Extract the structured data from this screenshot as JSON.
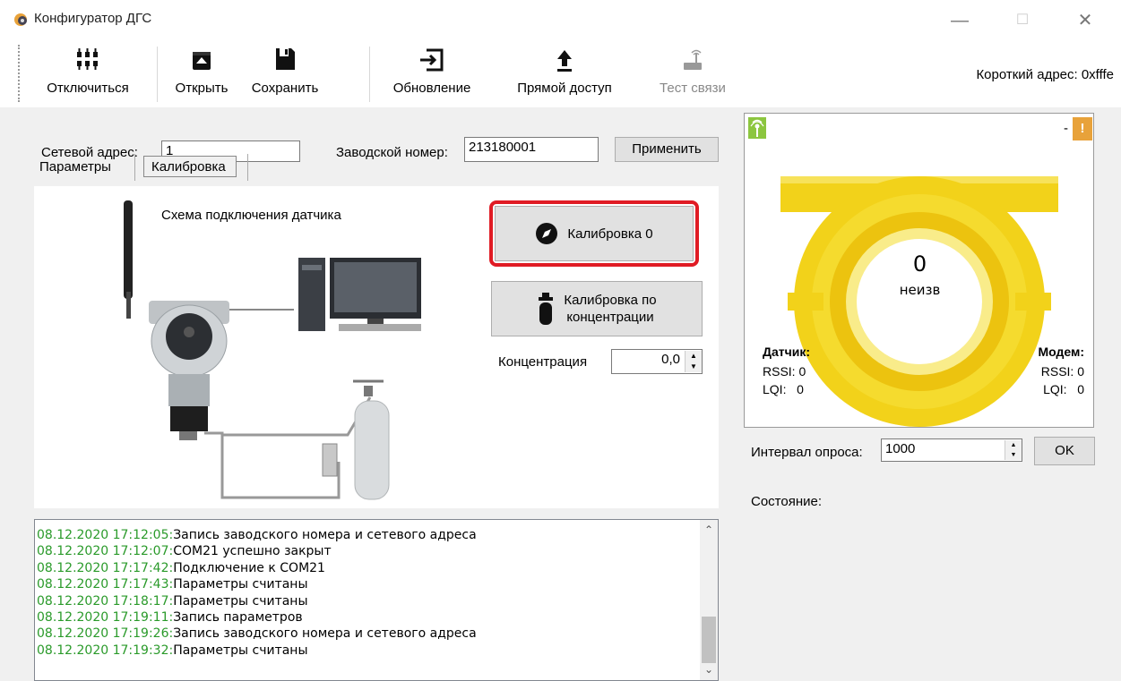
{
  "window": {
    "title": "Конфигуратор ДГС",
    "minimize": "—",
    "maximize": "☐",
    "close": "✕"
  },
  "toolbar": {
    "items": [
      {
        "label": "Отключиться",
        "icon": "disconnect-icon",
        "enabled": true
      },
      {
        "label": "Открыть",
        "icon": "open-icon",
        "enabled": true
      },
      {
        "label": "Сохранить",
        "icon": "save-icon",
        "enabled": true
      },
      {
        "label": "Обновление",
        "icon": "update-icon",
        "enabled": true
      },
      {
        "label": "Прямой доступ",
        "icon": "direct-access-icon",
        "enabled": true
      },
      {
        "label": "Тест связи",
        "icon": "link-test-icon",
        "enabled": false
      }
    ],
    "short_address": "Короткий адрес:  0xfffe"
  },
  "form": {
    "network_address_label": "Сетевой адрес:",
    "network_address_value": "1",
    "serial_label": "Заводской номер:",
    "serial_value": "213180001",
    "apply_label": "Применить"
  },
  "tabs": [
    {
      "label": "Параметры",
      "active": false
    },
    {
      "label": "Калибровка",
      "active": true
    }
  ],
  "calibration": {
    "diagram_caption": "Схема подключения датчика",
    "zero_button": "Калибровка 0",
    "conc_button_line1": "Калибровка по",
    "conc_button_line2": "концентрации",
    "concentration_label": "Концентрация",
    "concentration_value": "0,0"
  },
  "log": {
    "entries": [
      {
        "ts": "08.12.2020 17:12:05:",
        "msg": "Запись заводского номера и сетевого адреса"
      },
      {
        "ts": "08.12.2020 17:12:07:",
        "msg": "COM21 успешно закрыт"
      },
      {
        "ts": "08.12.2020 17:17:42:",
        "msg": "Подключение к COM21"
      },
      {
        "ts": "08.12.2020 17:17:43:",
        "msg": "Параметры считаны"
      },
      {
        "ts": "08.12.2020 17:18:17:",
        "msg": "Параметры считаны"
      },
      {
        "ts": "08.12.2020 17:19:11:",
        "msg": "Запись параметров"
      },
      {
        "ts": "08.12.2020 17:19:26:",
        "msg": "Запись заводского номера и сетевого адреса"
      },
      {
        "ts": "08.12.2020 17:19:32:",
        "msg": "Параметры считаны"
      }
    ]
  },
  "status": {
    "dash": "-",
    "warning": "!",
    "value": "0",
    "unit": "неизв",
    "sensor_title": "Датчик:",
    "sensor_rssi": "RSSI: 0",
    "sensor_lqi": "LQI:   0",
    "modem_title": "Модем:",
    "modem_rssi": "RSSI: 0",
    "modem_lqi": "LQI:   0",
    "yellow": "#f2d21a",
    "signal_green": "#8cc63f",
    "warning_orange": "#e8a23a"
  },
  "poll": {
    "label": "Интервал опроса:",
    "value": "1000",
    "ok_label": "OK"
  },
  "state_label": "Состояние:"
}
